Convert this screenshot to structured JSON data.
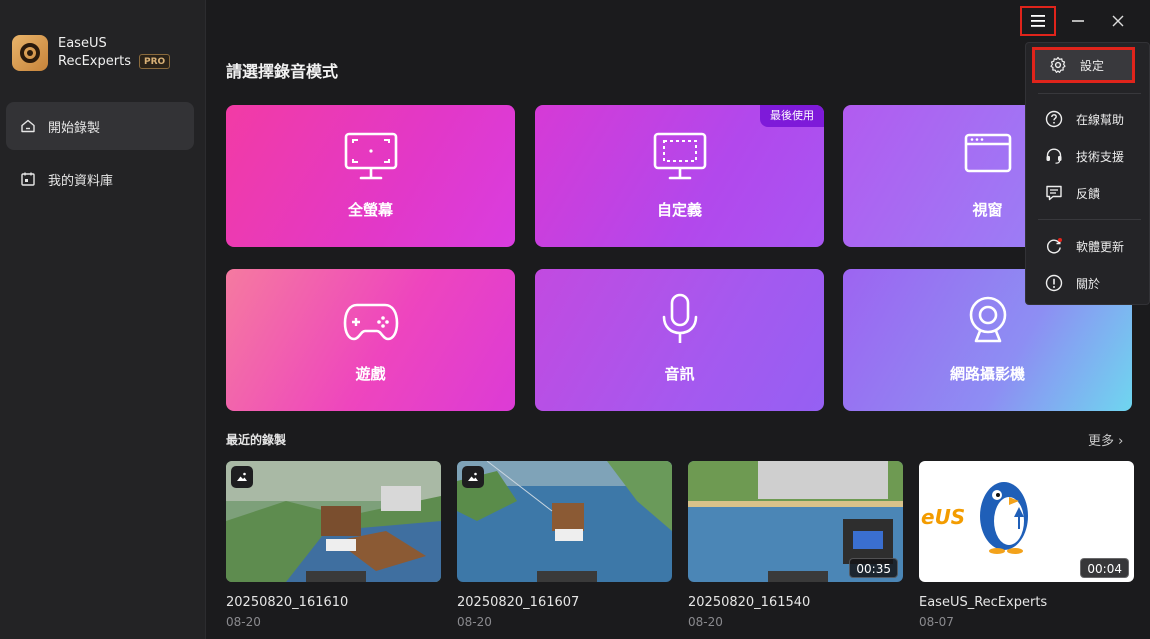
{
  "brand": {
    "name_line1": "EaseUS",
    "name_line2": "RecExperts",
    "pro_badge": "PRO"
  },
  "sidebar": {
    "items": [
      {
        "label": "開始錄製",
        "icon": "home-icon",
        "active": true
      },
      {
        "label": "我的資料庫",
        "icon": "library-icon",
        "active": false
      }
    ]
  },
  "main": {
    "title": "請選擇錄音模式",
    "modes": [
      {
        "label": "全螢幕",
        "icon": "full-screen-icon"
      },
      {
        "label": "自定義",
        "icon": "custom-region-icon",
        "badge": "最後使用"
      },
      {
        "label": "視窗",
        "icon": "window-icon"
      },
      {
        "label": "遊戲",
        "icon": "gamepad-icon"
      },
      {
        "label": "音訊",
        "icon": "microphone-icon"
      },
      {
        "label": "網路攝影機",
        "icon": "webcam-icon"
      }
    ],
    "recent_title": "最近的錄製",
    "more_label": "更多",
    "recordings": [
      {
        "name": "20250820_161610",
        "date": "08-20",
        "type": "image"
      },
      {
        "name": "20250820_161607",
        "date": "08-20",
        "type": "image"
      },
      {
        "name": "20250820_161540",
        "date": "08-20",
        "type": "video",
        "duration": "00:35"
      },
      {
        "name": "EaseUS_RecExperts",
        "date": "08-07",
        "type": "video",
        "duration": "00:04",
        "thumb_text": "eUS"
      }
    ]
  },
  "menu": {
    "items": [
      {
        "label": "設定",
        "icon": "gear-icon"
      },
      {
        "label": "在線幫助",
        "icon": "help-icon"
      },
      {
        "label": "技術支援",
        "icon": "headset-icon"
      },
      {
        "label": "反饋",
        "icon": "feedback-icon"
      },
      {
        "label": "軟體更新",
        "icon": "refresh-icon"
      },
      {
        "label": "關於",
        "icon": "info-icon"
      }
    ]
  },
  "colors": {
    "highlight": "#e0241b",
    "badge_purple": "#7e1ad9"
  }
}
